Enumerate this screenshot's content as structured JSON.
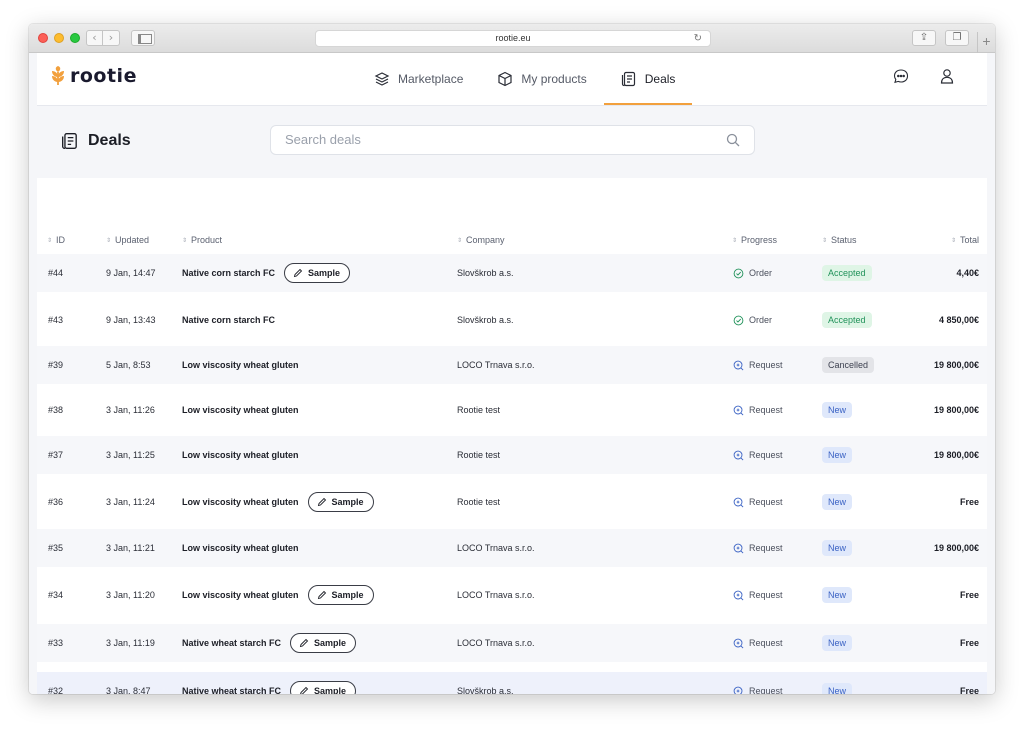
{
  "browser": {
    "url": "rootie.eu"
  },
  "brand": {
    "name": "rootie",
    "accent": "#f2a03d"
  },
  "nav": {
    "tabs": [
      {
        "label": "Marketplace",
        "icon": "layers-icon"
      },
      {
        "label": "My products",
        "icon": "cube-icon"
      },
      {
        "label": "Deals",
        "icon": "receipt-icon",
        "active": true
      }
    ]
  },
  "header": {
    "title": "Deals",
    "search_placeholder": "Search deals"
  },
  "table": {
    "columns": {
      "id": "ID",
      "updated": "Updated",
      "product": "Product",
      "company": "Company",
      "progress": "Progress",
      "status": "Status",
      "total": "Total"
    },
    "sample_label": "Sample",
    "rows": [
      {
        "id": "#44",
        "updated": "9 Jan, 14:47",
        "product": "Native corn starch FC",
        "sample": true,
        "company": "Slovškrob a.s.",
        "progress": "Order",
        "status": "Accepted",
        "total": "4,40€"
      },
      {
        "id": "#43",
        "updated": "9 Jan, 13:43",
        "product": "Native corn starch FC",
        "sample": false,
        "company": "Slovškrob a.s.",
        "progress": "Order",
        "status": "Accepted",
        "total": "4 850,00€"
      },
      {
        "id": "#39",
        "updated": "5 Jan, 8:53",
        "product": "Low viscosity wheat gluten",
        "sample": false,
        "company": "LOCO Trnava s.r.o.",
        "progress": "Request",
        "status": "Cancelled",
        "total": "19 800,00€"
      },
      {
        "id": "#38",
        "updated": "3 Jan, 11:26",
        "product": "Low viscosity wheat gluten",
        "sample": false,
        "company": "Rootie test",
        "progress": "Request",
        "status": "New",
        "total": "19 800,00€"
      },
      {
        "id": "#37",
        "updated": "3 Jan, 11:25",
        "product": "Low viscosity wheat gluten",
        "sample": false,
        "company": "Rootie test",
        "progress": "Request",
        "status": "New",
        "total": "19 800,00€"
      },
      {
        "id": "#36",
        "updated": "3 Jan, 11:24",
        "product": "Low viscosity wheat gluten",
        "sample": true,
        "company": "Rootie test",
        "progress": "Request",
        "status": "New",
        "total": "Free"
      },
      {
        "id": "#35",
        "updated": "3 Jan, 11:21",
        "product": "Low viscosity wheat gluten",
        "sample": false,
        "company": "LOCO Trnava s.r.o.",
        "progress": "Request",
        "status": "New",
        "total": "19 800,00€"
      },
      {
        "id": "#34",
        "updated": "3 Jan, 11:20",
        "product": "Low viscosity wheat gluten",
        "sample": true,
        "company": "LOCO Trnava s.r.o.",
        "progress": "Request",
        "status": "New",
        "total": "Free"
      },
      {
        "id": "#33",
        "updated": "3 Jan, 11:19",
        "product": "Native wheat starch FC",
        "sample": true,
        "company": "LOCO Trnava s.r.o.",
        "progress": "Request",
        "status": "New",
        "total": "Free"
      },
      {
        "id": "#32",
        "updated": "3 Jan, 8:47",
        "product": "Native wheat starch FC",
        "sample": true,
        "company": "Slovškrob a.s.",
        "progress": "Request",
        "status": "New",
        "total": "Free"
      }
    ]
  },
  "colors": {
    "accepted": "#21925a",
    "cancelled": "#3d4150",
    "new": "#3a62c4"
  }
}
